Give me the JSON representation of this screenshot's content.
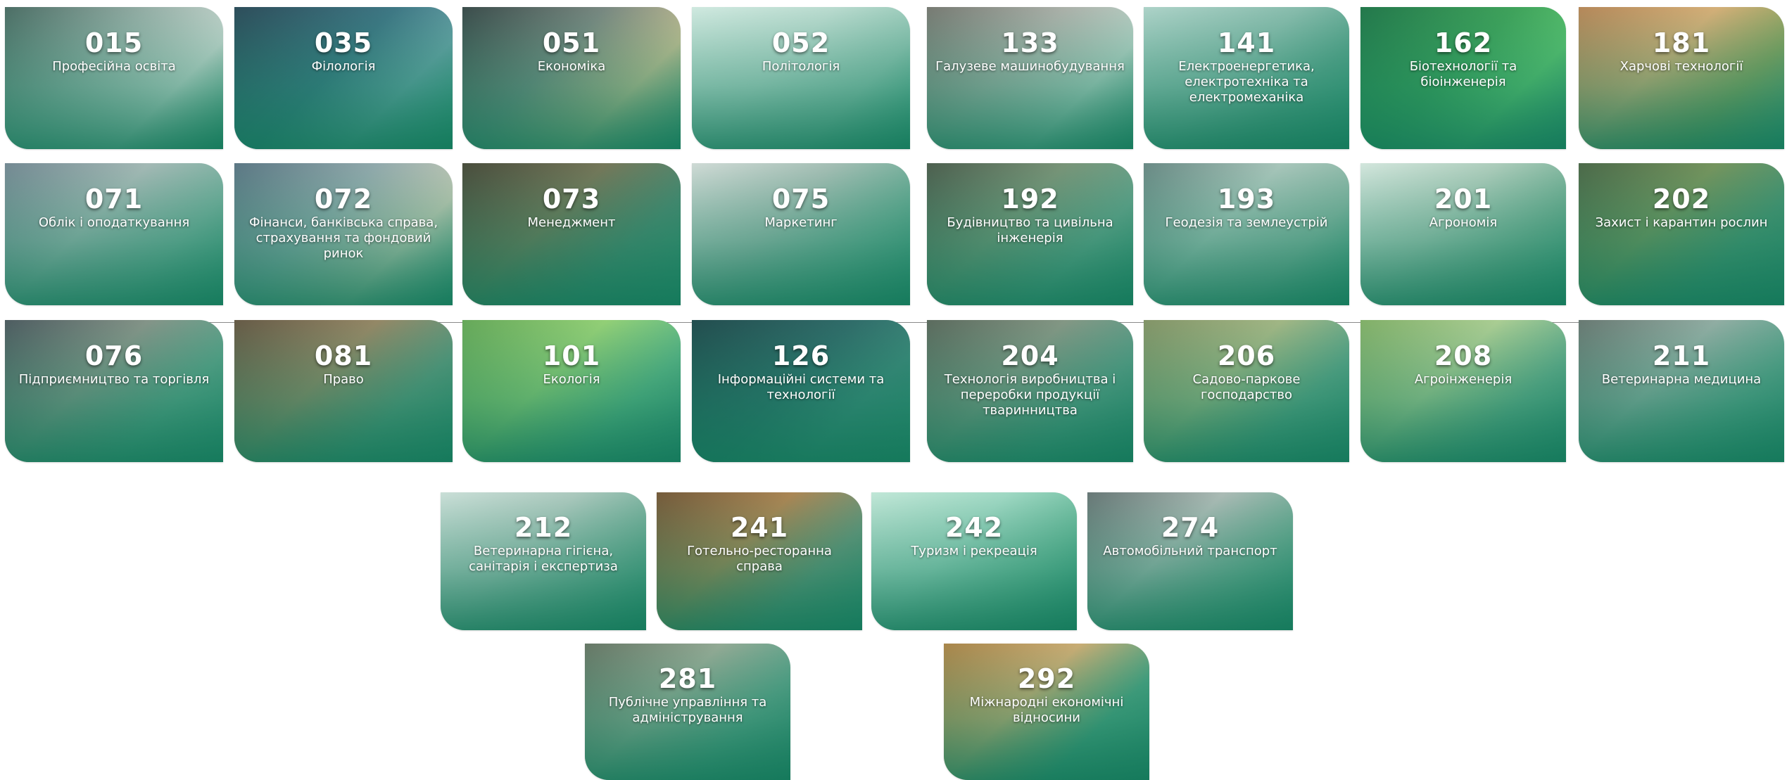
{
  "specialties": [
    {
      "code": "015",
      "title": "Професійна освіта"
    },
    {
      "code": "035",
      "title": "Філологія"
    },
    {
      "code": "051",
      "title": "Економіка"
    },
    {
      "code": "052",
      "title": "Політологія"
    },
    {
      "code": "133",
      "title": "Галузеве машинобудування"
    },
    {
      "code": "141",
      "title": "Електроенергетика, електротехніка та електромеханіка"
    },
    {
      "code": "162",
      "title": "Біотехнології та біоінженерія"
    },
    {
      "code": "181",
      "title": "Харчові технології"
    },
    {
      "code": "071",
      "title": "Облік і оподаткування"
    },
    {
      "code": "072",
      "title": "Фінанси, банківська справа, страхування та фондовий ринок"
    },
    {
      "code": "073",
      "title": "Менеджмент"
    },
    {
      "code": "075",
      "title": "Маркетинг"
    },
    {
      "code": "192",
      "title": "Будівництво та цивільна інженерія"
    },
    {
      "code": "193",
      "title": "Геодезія та землеустрій"
    },
    {
      "code": "201",
      "title": "Агрономія"
    },
    {
      "code": "202",
      "title": "Захист і карантин рослин"
    },
    {
      "code": "076",
      "title": "Підприємництво та торгівля"
    },
    {
      "code": "081",
      "title": "Право"
    },
    {
      "code": "101",
      "title": "Екологія"
    },
    {
      "code": "126",
      "title": "Інформаційні системи та технології"
    },
    {
      "code": "204",
      "title": "Технологія виробництва і переробки продукції тваринництва"
    },
    {
      "code": "206",
      "title": "Садово-паркове господарство"
    },
    {
      "code": "208",
      "title": "Агроінженерія"
    },
    {
      "code": "211",
      "title": "Ветеринарна медицина"
    },
    {
      "code": "212",
      "title": "Ветеринарна гігієна, санітарія і експертиза"
    },
    {
      "code": "241",
      "title": "Готельно-ресторанна справа"
    },
    {
      "code": "242",
      "title": "Туризм і рекреація"
    },
    {
      "code": "274",
      "title": "Автомобільний транспорт"
    },
    {
      "code": "281",
      "title": "Публічне управління та адміністрування"
    },
    {
      "code": "292",
      "title": "Міжнародні економічні відносини"
    }
  ]
}
